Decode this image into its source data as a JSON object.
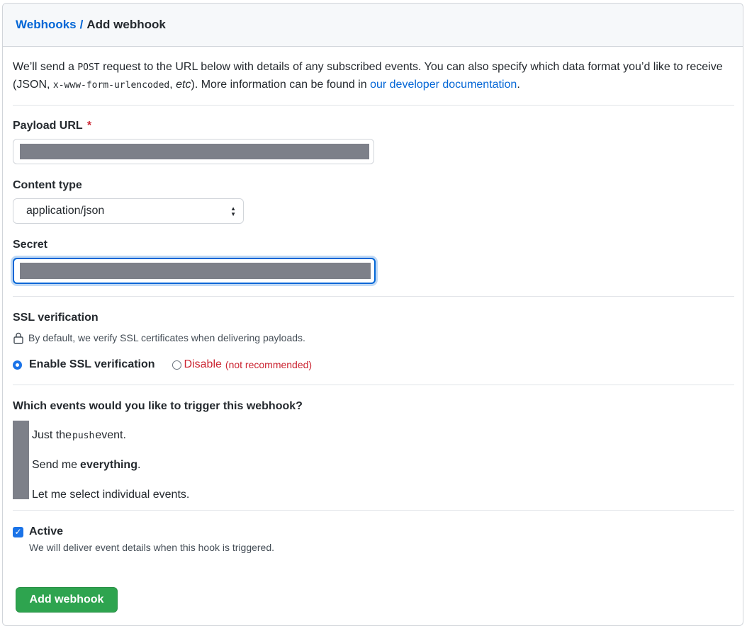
{
  "breadcrumb": {
    "parent": "Webhooks",
    "separator": "/",
    "current": "Add webhook"
  },
  "intro": {
    "part1": "We’ll send a ",
    "post": "POST",
    "part2": " request to the URL below with details of any subscribed events. You can also specify which data format you’d like to receive (JSON, ",
    "form": "x-www-form-urlencoded",
    "part3": ", ",
    "etc": "etc",
    "part4": "). More information can be found in ",
    "link": "our developer documentation",
    "part5": "."
  },
  "payload_url": {
    "label": "Payload URL",
    "required_mark": "*"
  },
  "content_type": {
    "label": "Content type",
    "selected": "application/json"
  },
  "secret": {
    "label": "Secret"
  },
  "ssl": {
    "title": "SSL verification",
    "note": "By default, we verify SSL certificates when delivering payloads.",
    "enable_label": "Enable SSL verification",
    "disable_label": "Disable",
    "disable_hint": "(not recommended)"
  },
  "events": {
    "question": "Which events would you like to trigger this webhook?",
    "opt1_a": "Just the ",
    "opt1_code": "push",
    "opt1_b": " event.",
    "opt2_a": "Send me ",
    "opt2_bold": "everything",
    "opt2_b": ".",
    "opt3": "Let me select individual events."
  },
  "active": {
    "label": "Active",
    "note": "We will deliver event details when this hook is triggered."
  },
  "submit_label": "Add webhook",
  "colors": {
    "accent": "#0366d6",
    "success": "#2ea44f",
    "danger": "#cb2431"
  }
}
